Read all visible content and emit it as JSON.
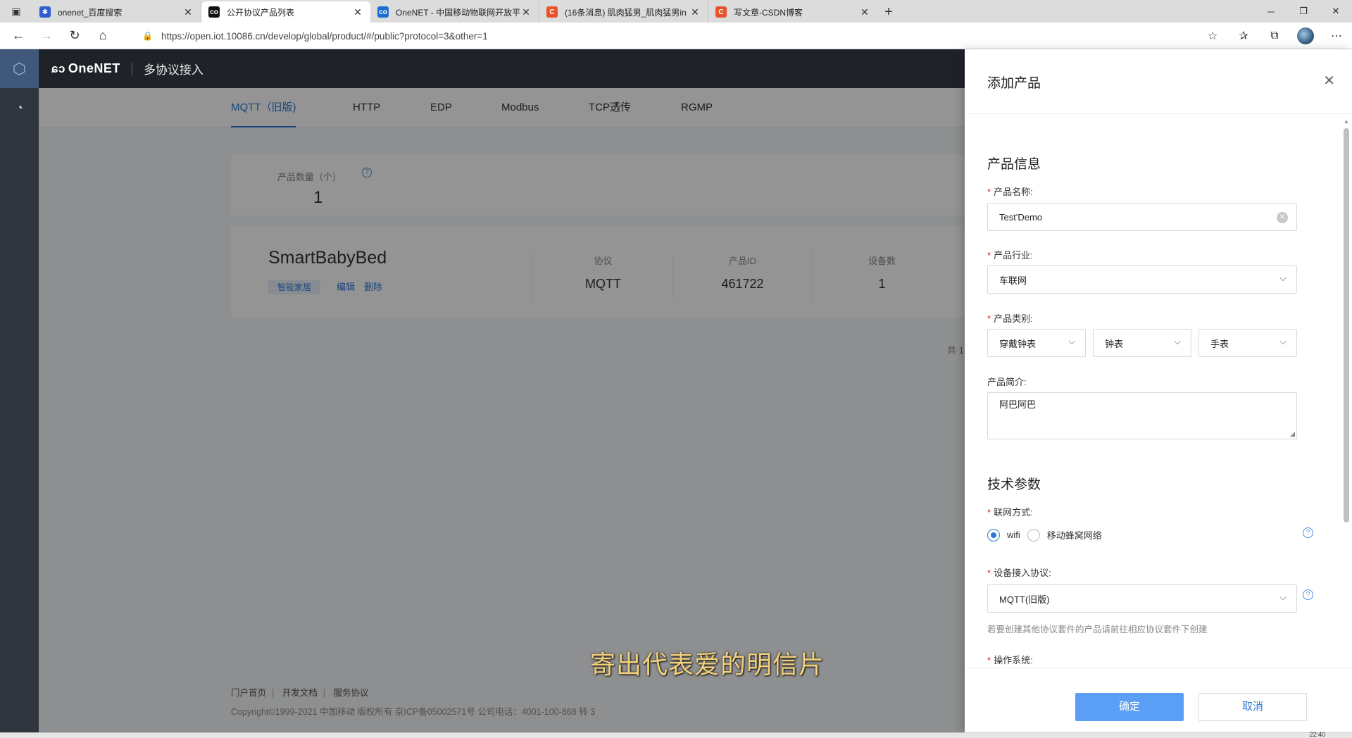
{
  "browser": {
    "tabs": [
      {
        "title": "onenet_百度搜索",
        "fav_color": "#2f5ccf",
        "fav_glyph": "🐾"
      },
      {
        "title": "公开协议产品列表",
        "fav_color": "#111111",
        "fav_glyph": "co",
        "active": true
      },
      {
        "title": "OneNET - 中国移动物联网开放平",
        "fav_color": "#1b6fd1",
        "fav_glyph": "co"
      },
      {
        "title": "(16条消息) 肌肉猛男_肌肉猛男in",
        "fav_color": "#e8532b",
        "fav_glyph": "C"
      },
      {
        "title": "写文章-CSDN博客",
        "fav_color": "#e8532b",
        "fav_glyph": "C"
      }
    ],
    "url": "https://open.iot.10086.cn/develop/global/product/#/public?protocol=3&other=1"
  },
  "app": {
    "logo": "OneNET",
    "section": "多协议接入",
    "protocol_tabs": [
      "MQTT（旧版)",
      "HTTP",
      "EDP",
      "Modbus",
      "TCP透传",
      "RGMP"
    ],
    "stats": {
      "label": "产品数量（个）",
      "value": "1"
    },
    "product": {
      "name": "SmartBabyBed",
      "tag": "智能家居",
      "edit": "编辑",
      "delete": "删除",
      "protocol_header": "协议",
      "protocol_value": "MQTT",
      "id_header": "产品ID",
      "id_value": "461722",
      "devices_header": "设备数",
      "devices_value": "1"
    },
    "total": "共 1",
    "footer": {
      "links": [
        "门户首页",
        "开发文档",
        "服务协议"
      ],
      "copyright": "Copyright©1999-2021 中国移动 版权所有 京ICP备05002571号 公司电话：4001-100-868 转 3"
    }
  },
  "subtitle": "寄出代表爱的明信片",
  "drawer": {
    "title": "添加产品",
    "section_info": "产品信息",
    "name_label": "产品名称:",
    "name_value": "Test'Demo",
    "industry_label": "产品行业:",
    "industry_value": "车联网",
    "category_label": "产品类别:",
    "category_values": [
      "穿戴钟表",
      "钟表",
      "手表"
    ],
    "intro_label": "产品简介:",
    "intro_value": "阿巴阿巴",
    "section_tech": "技术参数",
    "network_label": "联网方式:",
    "network_options": [
      "wifi",
      "移动蜂窝网络"
    ],
    "network_selected": "wifi",
    "protocol_label": "设备接入协议:",
    "protocol_value": "MQTT(旧版)",
    "protocol_hint": "若要创建其他协议套件的产品请前往相应协议套件下创建",
    "os_label": "操作系统:",
    "ok": "确定",
    "cancel": "取消"
  },
  "clock_partial": "22:40"
}
